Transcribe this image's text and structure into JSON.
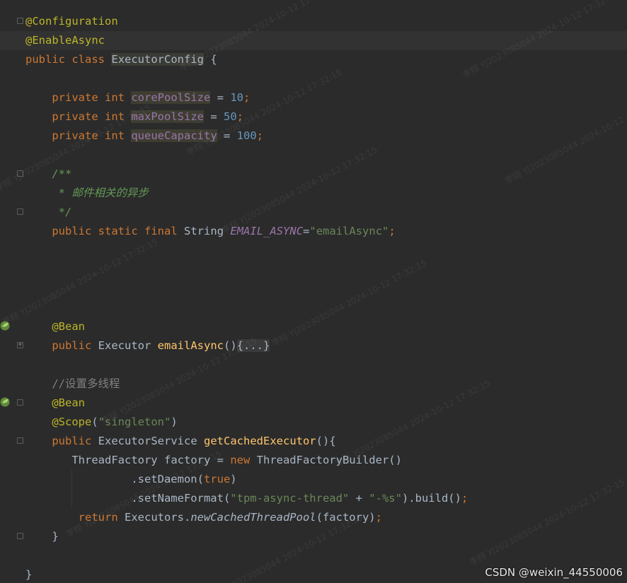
{
  "code": {
    "l1_ann": "@Configuration",
    "l2_ann": "@EnableAsync",
    "l3_public": "public",
    "l3_class": "class",
    "l3_name": "ExecutorConfig",
    "l3_brace": " {",
    "l5_private": "private",
    "l5_int": "int",
    "l5_field": "corePoolSize",
    "l5_eq": " = ",
    "l5_val": "10",
    "l5_semi": ";",
    "l6_private": "private",
    "l6_int": "int",
    "l6_field": "maxPoolSize",
    "l6_eq": " = ",
    "l6_val": "50",
    "l6_semi": ";",
    "l7_private": "private",
    "l7_int": "int",
    "l7_field": "queueCapacity",
    "l7_eq": " = ",
    "l7_val": "100",
    "l7_semi": ";",
    "l9_comment": "/**",
    "l10_comment": " * 邮件相关的异步",
    "l11_comment": " */",
    "l12_public": "public",
    "l12_static": "static",
    "l12_final": "final",
    "l12_type": "String",
    "l12_field": "EMAIL_ASYNC",
    "l12_eq": "=",
    "l12_str": "\"emailAsync\"",
    "l12_semi": ";",
    "l17_ann": "@Bean",
    "l18_public": "public",
    "l18_type": "Executor",
    "l18_method": "emailAsync",
    "l18_paren": "()",
    "l18_folded": "{...}",
    "l20_comment": "//设置多线程",
    "l21_ann": "@Bean",
    "l22_ann": "@Scope",
    "l22_open": "(",
    "l22_str": "\"singleton\"",
    "l22_close": ")",
    "l23_public": "public",
    "l23_type": "ExecutorService",
    "l23_method": "getCachedExecutor",
    "l23_rest": "(){",
    "l24_type": "ThreadFactory",
    "l24_var": " factory = ",
    "l24_new": "new",
    "l24_rest": " ThreadFactoryBuilder()",
    "l25_call": ".setDaemon(",
    "l25_true": "true",
    "l25_close": ")",
    "l26_call": ".setNameFormat(",
    "l26_str1": "\"tpm-async-thread\"",
    "l26_plus": " + ",
    "l26_str2": "\"-%s\"",
    "l26_rest": ").build()",
    "l26_semi": ";",
    "l27_return": "return",
    "l27_cls": " Executors.",
    "l27_static": "newCachedThreadPool",
    "l27_rest": "(factory)",
    "l27_semi": ";",
    "l28_brace": "}",
    "l30_brace": "}"
  },
  "watermark": {
    "text": "李翔 YJ20230850​44 2024-10-12 17:32:15"
  },
  "footer": {
    "credit": "CSDN @weixin_44550006"
  },
  "icons": {
    "bean_gutter": "spring-bean-icon",
    "fold": "fold-toggle-icon"
  }
}
